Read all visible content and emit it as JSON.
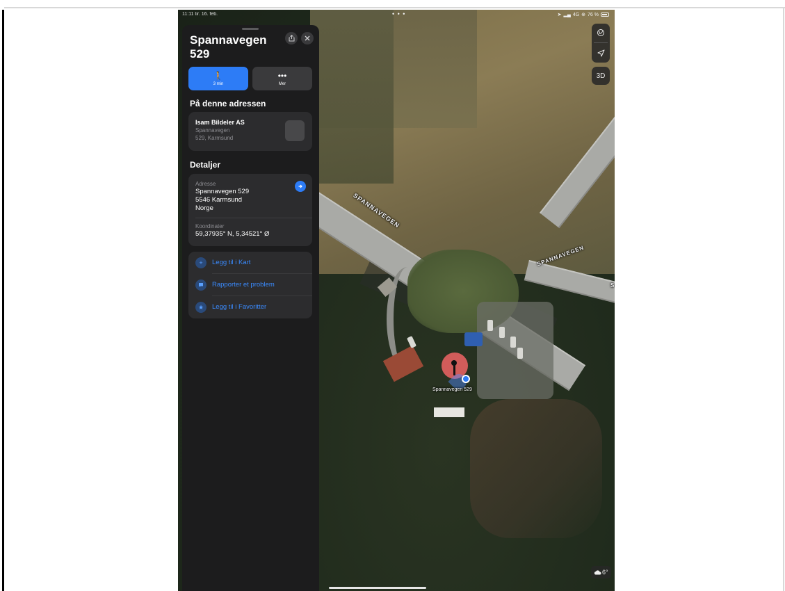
{
  "status_bar": {
    "time": "11:11 tir. 16. feb.",
    "dots": "• • •",
    "signal": "4G",
    "battery_percent": "76 %"
  },
  "place": {
    "title": "Spannavegen 529",
    "actions": [
      {
        "icon": "walking-person-icon",
        "label": "3 min"
      },
      {
        "icon": "ellipsis-icon",
        "label": "Mer"
      }
    ]
  },
  "at_address": {
    "heading": "På denne adressen",
    "business_name": "Isam Bildeler AS",
    "business_line1": "Spannavegen",
    "business_line2": "529, Karmsund"
  },
  "details": {
    "heading": "Detaljer",
    "address_label": "Adresse",
    "address_lines": "Spannavegen 529\n5546 Karmsund\nNorge",
    "coords_label": "Koordinater",
    "coords_value": "59,37935° N, 5,34521° Ø"
  },
  "more_actions": [
    {
      "icon": "plus-icon",
      "label": "Legg til i Kart"
    },
    {
      "icon": "speech-bubble-icon",
      "label": "Rapporter et problem"
    },
    {
      "icon": "star-icon",
      "label": "Legg til i Favoritter"
    }
  ],
  "map": {
    "road_label_main": "SPANNAVEGEN",
    "road_label_secondary": "SPANNAVEGEN",
    "road_label_edge": "S",
    "pin_label": "Spannavegen 529",
    "btn_3d": "3D",
    "weather": "6°"
  },
  "colors": {
    "accent": "#2d7cf6",
    "panel_bg": "#1c1c1d",
    "card_bg": "#2c2c2e",
    "pin": "#e06060"
  }
}
